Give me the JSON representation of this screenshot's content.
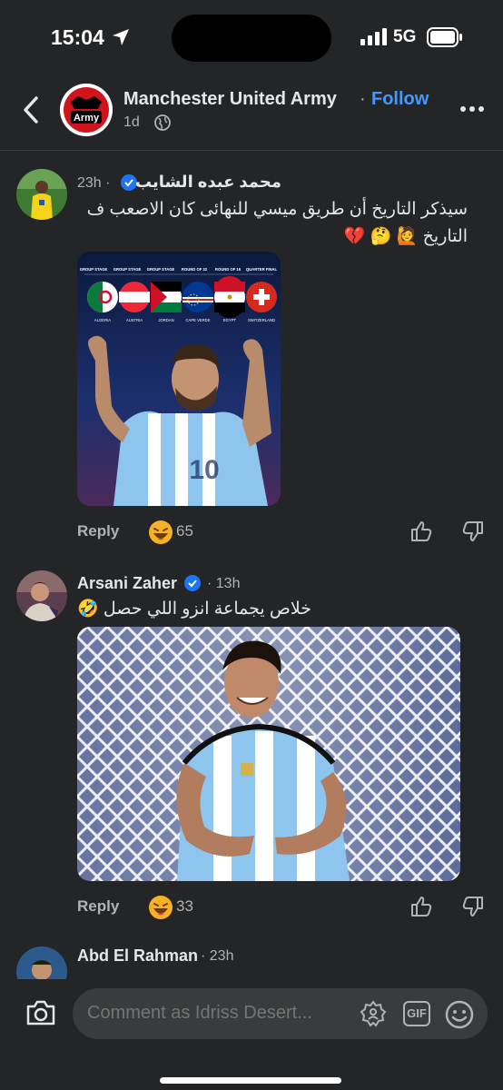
{
  "status_bar": {
    "time": "15:04",
    "network": "5G"
  },
  "header": {
    "group_name": "Manchester United Army",
    "separator": "·",
    "follow_label": "Follow",
    "post_time": "1d",
    "avatar_text": "Army"
  },
  "comments": [
    {
      "author": "محمد عبده الشايب",
      "time": "23h ·",
      "verified": true,
      "text_line1": "سيذكر التاريخ أن طريق ميسي للنهائى كان الاصعب ف",
      "text_line2": "التاريخ 🙋 🤔 💔",
      "image_labels": {
        "stages": [
          "GROUP STAGE",
          "GROUP STAGE",
          "GROUP STAGE",
          "ROUND OF 32",
          "ROUND OF 16",
          "QUARTER FINAL"
        ],
        "teams": [
          "ALGERIA",
          "AUSTRIA",
          "JORDAN",
          "CAPE VERDE",
          "EGYPT",
          "SWITZERLAND"
        ]
      },
      "reaction_emoji": "😄",
      "reaction_count": "65",
      "reply_label": "Reply"
    },
    {
      "author": "Arsani Zaher",
      "time": "· 13h",
      "verified": true,
      "text_line1": "خلاص يجماعة انزو اللي حصل 🤣",
      "reaction_emoji": "😄",
      "reaction_count": "33",
      "reply_label": "Reply"
    },
    {
      "author": "Abd El Rahman",
      "time": "· 23h"
    }
  ],
  "composer": {
    "placeholder": "Comment as Idriss Desert..."
  },
  "colors": {
    "background": "#242526",
    "accent": "#4599ff",
    "muted": "#b0b3b8",
    "text": "#e4e6eb"
  },
  "icons": [
    "location-arrow-icon",
    "signal-icon",
    "battery-icon",
    "back-icon",
    "globe-icon",
    "more-icon",
    "verified-icon",
    "like-icon",
    "dislike-icon",
    "camera-icon",
    "avatar-sticker-icon",
    "gif-icon",
    "emoji-icon"
  ]
}
